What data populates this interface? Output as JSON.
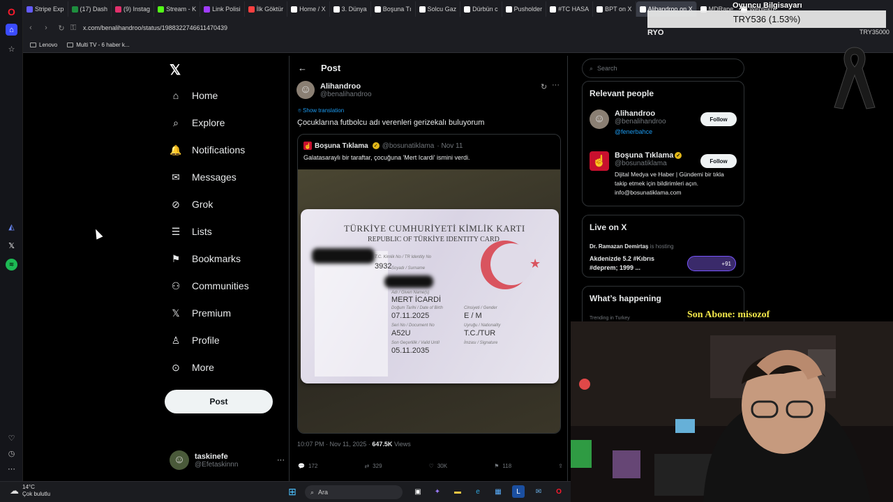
{
  "browser": {
    "tabs": [
      {
        "label": "Stripe Exp",
        "color": "#635bff"
      },
      {
        "label": "(17) Dash",
        "color": "#1e8e3e"
      },
      {
        "label": "(9) Instag",
        "color": "#e1306c"
      },
      {
        "label": "Stream - K",
        "color": "#53fc18"
      },
      {
        "label": "Link Polisi",
        "color": "#a03cff"
      },
      {
        "label": "İlk Göktür",
        "color": "#ff4040"
      },
      {
        "label": "Home / X",
        "color": "#ffffff"
      },
      {
        "label": "3. Dünya",
        "color": "#ffffff"
      },
      {
        "label": "Boşuna Tı",
        "color": "#ffffff"
      },
      {
        "label": "Solcu Gaz",
        "color": "#ffffff"
      },
      {
        "label": "Dürbün c",
        "color": "#ffffff"
      },
      {
        "label": "Pusholder",
        "color": "#ffffff"
      },
      {
        "label": "#TC HASA",
        "color": "#ffffff"
      },
      {
        "label": "BPT on X",
        "color": "#ffffff"
      },
      {
        "label": "Alihandroo on X",
        "color": "#ffffff",
        "active": true
      },
      {
        "label": "MDRape",
        "color": "#ffffff"
      },
      {
        "label": "Webtekn",
        "color": "#ffffff"
      }
    ],
    "url": "x.com/benalihandroo/status/1988322746611470439",
    "bookmarks": [
      "Lenovo",
      "Multi TV - 6 haber k..."
    ]
  },
  "stream_overlay": {
    "money": "TRY536 (1.53%)",
    "top_label": "Oyuncu Bilgisayarı",
    "ryo": "RYO",
    "try_total": "TRY35000",
    "son_abone": "Son Abone: misozof"
  },
  "left_nav": {
    "items": [
      {
        "label": "Home",
        "icon": "home-icon"
      },
      {
        "label": "Explore",
        "icon": "search-icon"
      },
      {
        "label": "Notifications",
        "icon": "bell-icon"
      },
      {
        "label": "Messages",
        "icon": "mail-icon"
      },
      {
        "label": "Grok",
        "icon": "grok-icon"
      },
      {
        "label": "Lists",
        "icon": "list-icon"
      },
      {
        "label": "Bookmarks",
        "icon": "bookmark-icon"
      },
      {
        "label": "Communities",
        "icon": "people-icon"
      },
      {
        "label": "Premium",
        "icon": "x-icon"
      },
      {
        "label": "Profile",
        "icon": "person-icon"
      },
      {
        "label": "More",
        "icon": "more-icon"
      }
    ],
    "post_button": "Post",
    "user": {
      "name": "taskinefe",
      "handle": "@Efetaskinnn"
    }
  },
  "post": {
    "header": "Post",
    "author_name": "Alihandroo",
    "author_handle": "@benalihandroo",
    "show_translation": "Show translation",
    "text": "Çocuklarına futbolcu adı verenleri gerizekalı buluyorum",
    "quote": {
      "name": "Boşuna Tıklama",
      "handle": "@bosunatiklama",
      "date": "· Nov 11",
      "text": "Galatasaraylı bir taraftar, çocuğuna 'Mert Icardi' ismini verdi."
    },
    "id_card": {
      "title": "TÜRKİYE CUMHURİYETİ KİMLİK KARTI",
      "subtitle": "REPUBLIC OF TÜRKİYE IDENTITY CARD",
      "tc_label": "T.C. Kimlik No / TR Identity No",
      "tc_value": "3932",
      "surname_label": "Soyadı / Surname",
      "name_label": "Adı / Given Name(s)",
      "name_value": "MERT İCARDİ",
      "dob_label": "Doğum Tarihi / Date of Birth",
      "dob_value": "07.11.2025",
      "gender_label": "Cinsiyeti / Gender",
      "gender_value": "E / M",
      "serial_label": "Seri No / Document No",
      "serial_value": "A52U",
      "nationality_label": "Uyruğu / Nationality",
      "nationality_value": "T.C./TUR",
      "valid_label": "Son Geçerlilik / Valid Until",
      "valid_value": "05.11.2035",
      "signature_label": "İmzası / Signature"
    },
    "time": "10:07 PM · Nov 11, 2025 ·",
    "views_count": "647.5K",
    "views_label": "Views",
    "actions": {
      "replies": "172",
      "reposts": "329",
      "likes": "30K",
      "bookmarks": "118"
    }
  },
  "right": {
    "search_placeholder": "Search",
    "relevant_title": "Relevant people",
    "people": [
      {
        "name": "Alihandroo",
        "handle": "@benalihandroo",
        "bio": "@fenerbahce",
        "follow": "Follow"
      },
      {
        "name": "Boşuna Tıklama",
        "handle": "@bosunatiklama",
        "bio": "Dijital Medya ve Haber | Gündemi bir tıkla takip etmek için bildirimleri açın. info@bosunatiklama.com",
        "follow": "Follow"
      }
    ],
    "live_title": "Live on X",
    "live_host": "Dr. Ramazan Demirtaş",
    "live_hosting": "is hosting",
    "live_text": "Akdenizde 5.2 #Kıbrıs #deprem; 1999 ...",
    "live_count": "+91",
    "happening_title": "What’s happening",
    "trending_label": "Trending in Turkey"
  },
  "taskbar": {
    "temp": "14°C",
    "condition": "Çok bulutlu",
    "search": "Ara"
  }
}
